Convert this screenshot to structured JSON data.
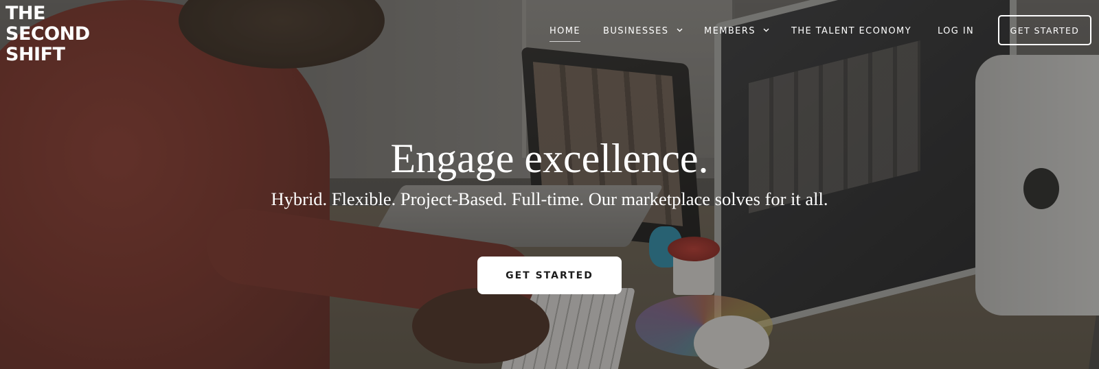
{
  "brand": {
    "logo_lines": [
      "THE",
      "SECOND",
      "SHIFT"
    ]
  },
  "nav": {
    "items": [
      {
        "label": "HOME",
        "active": true
      },
      {
        "label": "BUSINESSES",
        "dropdown": true
      },
      {
        "label": "MEMBERS",
        "dropdown": true
      },
      {
        "label": "THE TALENT ECONOMY"
      },
      {
        "label": "LOG IN"
      }
    ],
    "cta_label": "GET STARTED",
    "chevron_icon": "chevron-down-icon"
  },
  "hero": {
    "headline": "Engage excellence.",
    "subheadline": "Hybrid. Flexible. Project-Based. Full-time. Our marketplace solves for it all.",
    "cta_label": "GET STARTED",
    "background_image": "woman-at-desk-with-laptop-and-monitor-photo"
  },
  "colors": {
    "text": "#ffffff",
    "overlay": "#1e1c1b",
    "cta_background": "#ffffff",
    "cta_text": "#1c1c1c"
  }
}
